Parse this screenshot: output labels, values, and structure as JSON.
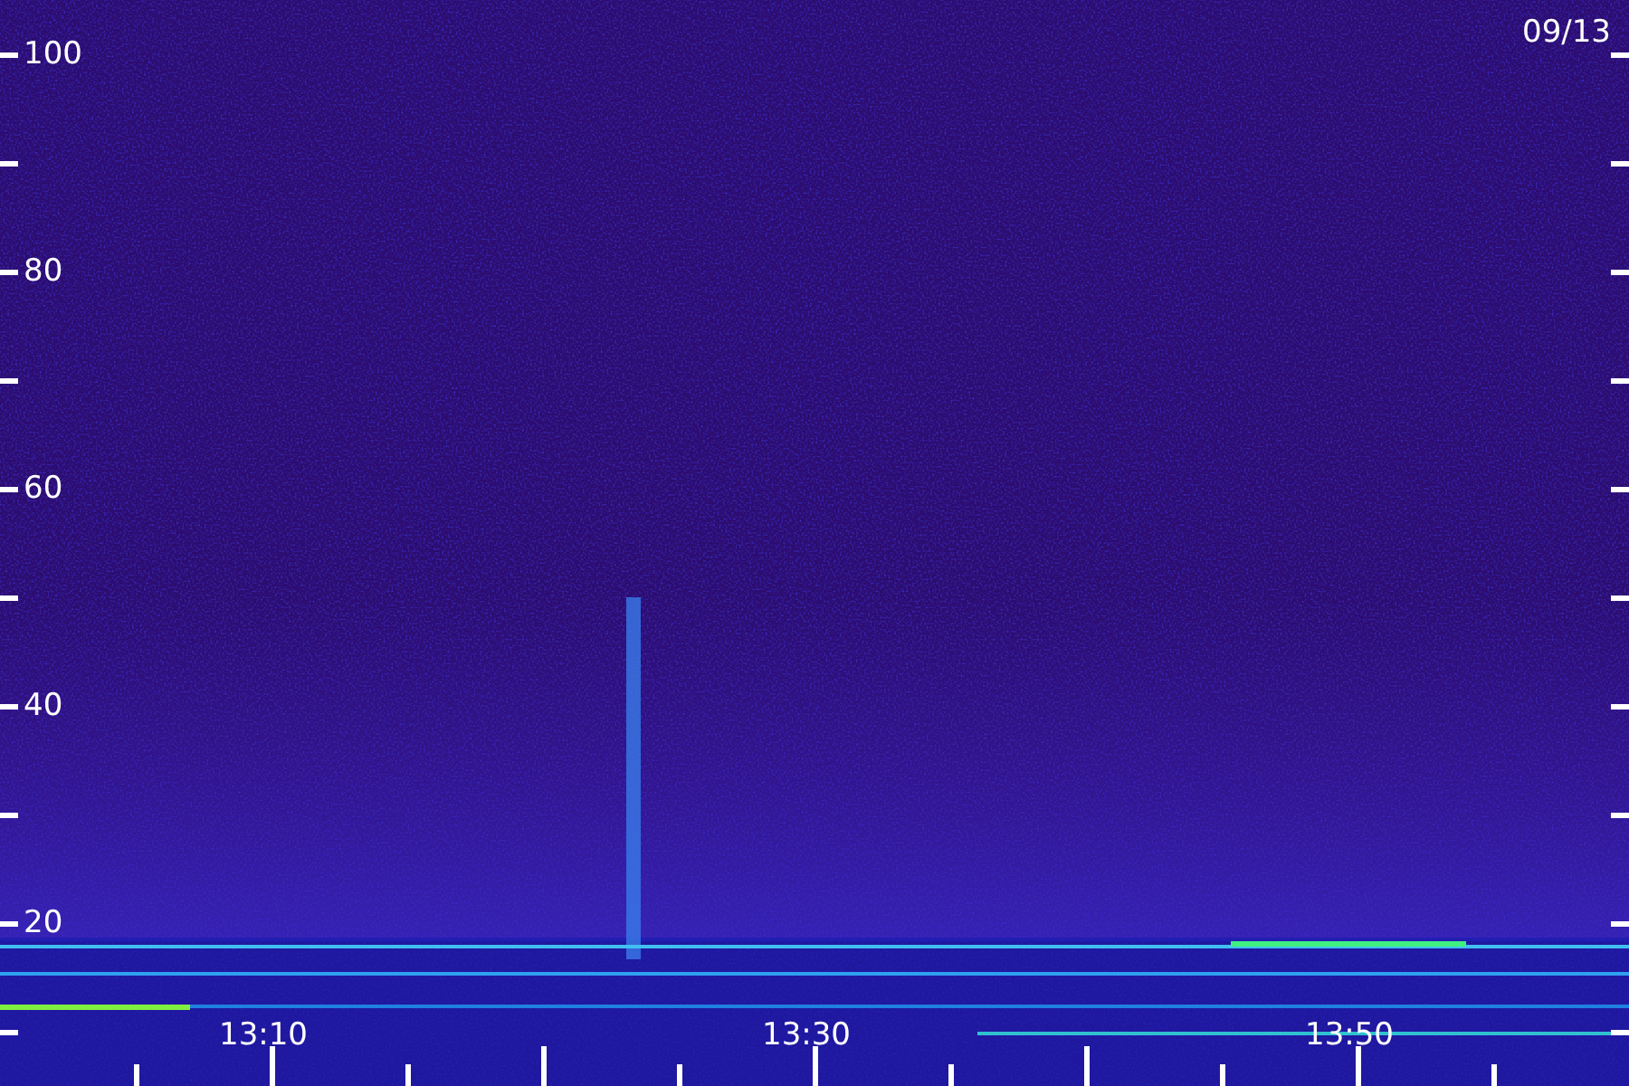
{
  "date": "09/13",
  "y_axis": {
    "labels": [
      "100",
      "80",
      "60",
      "40",
      "20"
    ]
  },
  "x_axis": {
    "labels": [
      "13:10",
      "13:30",
      "13:50"
    ]
  }
}
